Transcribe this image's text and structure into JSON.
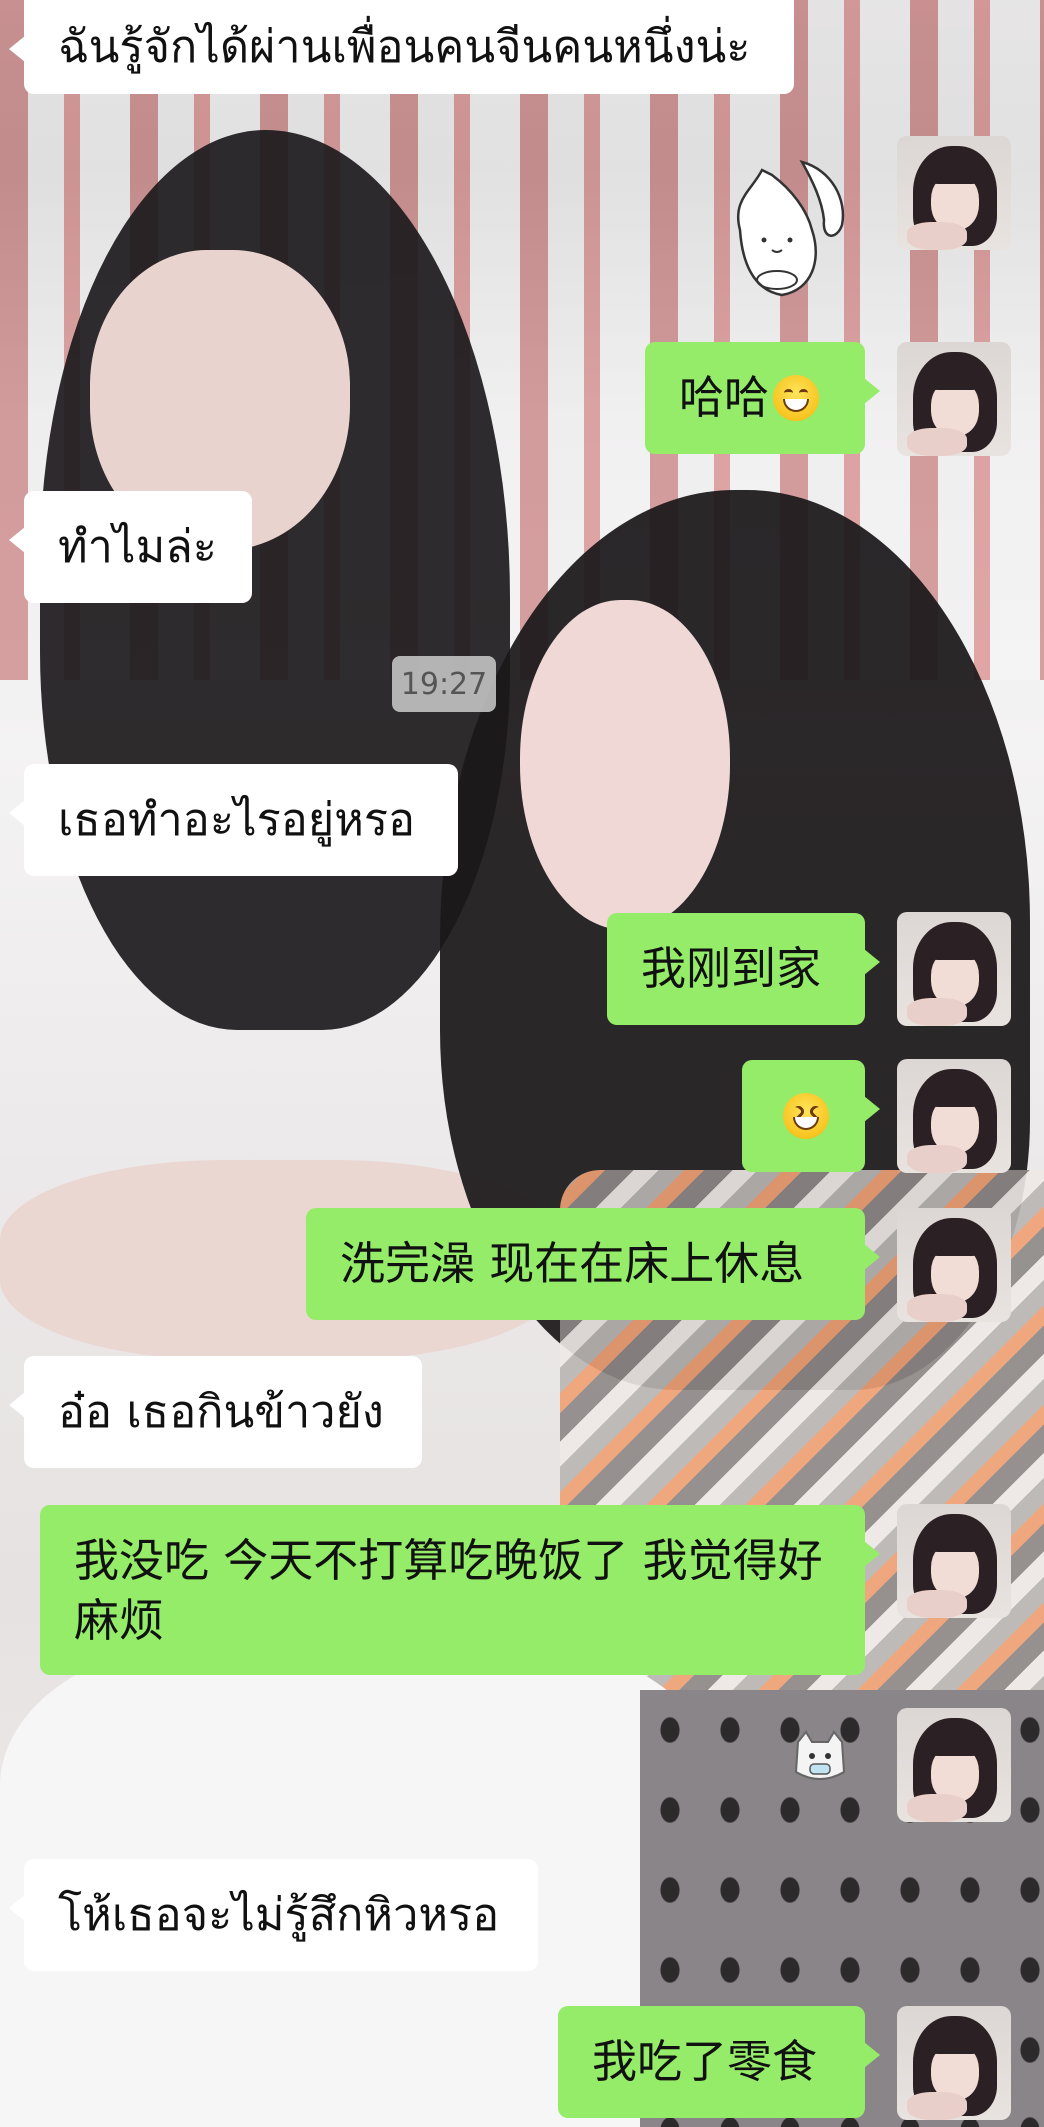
{
  "time_divider": "19:27",
  "messages": [
    {
      "id": "m1",
      "side": "in",
      "text": "ฉันรู้จักได้ผ่านเพื่อนคนจีนคนหนึ่งน่ะ"
    },
    {
      "id": "m2",
      "side": "out",
      "type": "sticker",
      "sticker": "bunny-sticker"
    },
    {
      "id": "m3",
      "side": "out",
      "text": "哈哈",
      "emoji": "grinning-emoji"
    },
    {
      "id": "m4",
      "side": "in",
      "text": "ทำไมล่ะ"
    },
    {
      "id": "m5",
      "side": "in",
      "text": "เธอทำอะไรอยู่หรอ"
    },
    {
      "id": "m6",
      "side": "out",
      "text": "我刚到家"
    },
    {
      "id": "m7",
      "side": "out",
      "type": "emoji",
      "emoji": "laughing-emoji"
    },
    {
      "id": "m8",
      "side": "out",
      "text": "洗完澡 现在在床上休息"
    },
    {
      "id": "m9",
      "side": "in",
      "text": "อ๋อ เธอกินข้าวยัง"
    },
    {
      "id": "m10",
      "side": "out",
      "text": "我没吃 今天不打算吃晚饭了 我觉得好麻烦"
    },
    {
      "id": "m11",
      "side": "out",
      "type": "sticker",
      "sticker": "cat-sticker"
    },
    {
      "id": "m12",
      "side": "in",
      "text": "โห้เธอจะไม่รู้สึกหิวหรอ"
    },
    {
      "id": "m13",
      "side": "out",
      "text": "我吃了零食"
    }
  ],
  "colors": {
    "outgoing_bubble": "#95ec69",
    "incoming_bubble": "#ffffff",
    "time_badge": "#cdcdcd"
  }
}
